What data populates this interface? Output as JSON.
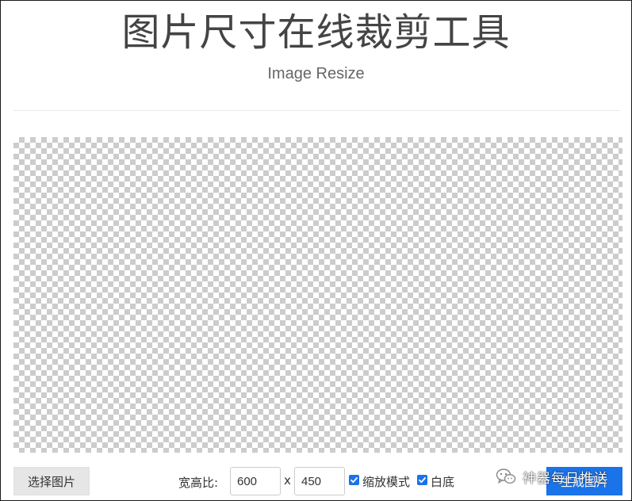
{
  "header": {
    "title": "图片尺寸在线裁剪工具",
    "subtitle": "Image Resize"
  },
  "canvas": {
    "background": "transparent-checkerboard"
  },
  "toolbar": {
    "select_label": "选择图片",
    "ratio_label": "宽高比:",
    "width_value": "600",
    "times_symbol": "x",
    "height_value": "450",
    "scale_mode_label": "缩放模式",
    "scale_mode_checked": true,
    "white_bg_label": "白底",
    "white_bg_checked": true,
    "generate_label": "生成图片"
  },
  "watermark": {
    "text": "神器每日推送",
    "icon": "wechat-icon"
  },
  "colors": {
    "accent": "#1a73e8",
    "button_gray": "#e6e6e6",
    "title_text": "#444444"
  }
}
